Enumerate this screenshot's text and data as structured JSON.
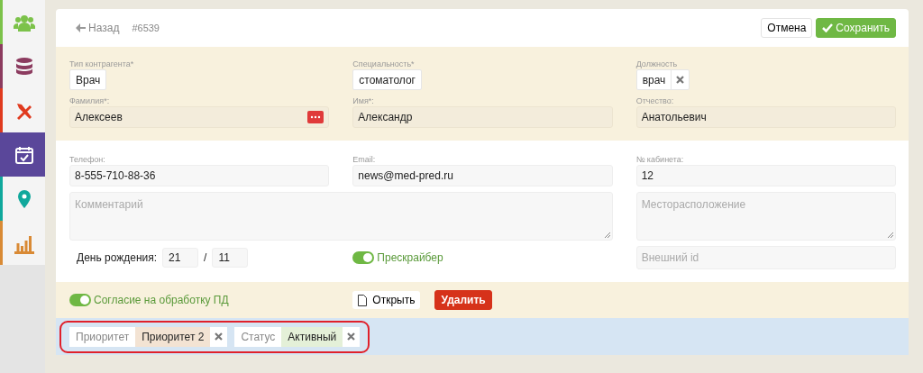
{
  "sidebar": {
    "items": [
      {
        "kind": "people",
        "color": "#7cc24a",
        "selected": false
      },
      {
        "kind": "database",
        "color": "#8c3b5f",
        "selected": false
      },
      {
        "kind": "tools",
        "color": "#e03a1e",
        "selected": false
      },
      {
        "kind": "calendar",
        "color": "#5a479a",
        "selected": true
      },
      {
        "kind": "pin",
        "color": "#10a89c",
        "selected": false
      },
      {
        "kind": "chart",
        "color": "#d98a35",
        "selected": false
      }
    ]
  },
  "header": {
    "back": "Назад",
    "record_id": "#6539",
    "cancel": "Отмена",
    "save": "Сохранить"
  },
  "main_fields": [
    {
      "kind": "chip",
      "label": "Тип контрагента*",
      "value": "Врач"
    },
    {
      "kind": "chip",
      "label": "Специальность*",
      "value": "стоматолог"
    },
    {
      "kind": "chip_removable",
      "label": "Должность",
      "value": "врач"
    },
    {
      "kind": "input_action",
      "label": "Фамилия*:",
      "value": "Алексеев"
    },
    {
      "kind": "input",
      "label": "Имя*:",
      "value": "Александр"
    },
    {
      "kind": "input",
      "label": "Отчество:",
      "value": "Анатольевич"
    }
  ],
  "contact_fields": [
    {
      "label": "Телефон:",
      "value": "8-555-710-88-36"
    },
    {
      "label": "Email:",
      "value": "news@med-pred.ru"
    },
    {
      "label": "№ кабинета:",
      "value": "12"
    }
  ],
  "comment": {
    "placeholder": "Комментарий"
  },
  "location": {
    "placeholder": "Месторасположение"
  },
  "birthday": {
    "label": "День рождения:",
    "day": "21",
    "separator": "/",
    "month": "11"
  },
  "prescriber": {
    "label": "Прескрайбер",
    "on": true
  },
  "external_id": {
    "placeholder": "Внешний id"
  },
  "consent": {
    "label": "Согласие на обработку ПД",
    "on": true
  },
  "open_button": "Открыть",
  "delete_button": "Удалить",
  "tags": [
    {
      "label": "Приоритет",
      "value": "Приоритет 2",
      "color": "#f3e3d3"
    },
    {
      "label": "Статус",
      "value": "Активный",
      "color": "#e4f0d8"
    }
  ]
}
